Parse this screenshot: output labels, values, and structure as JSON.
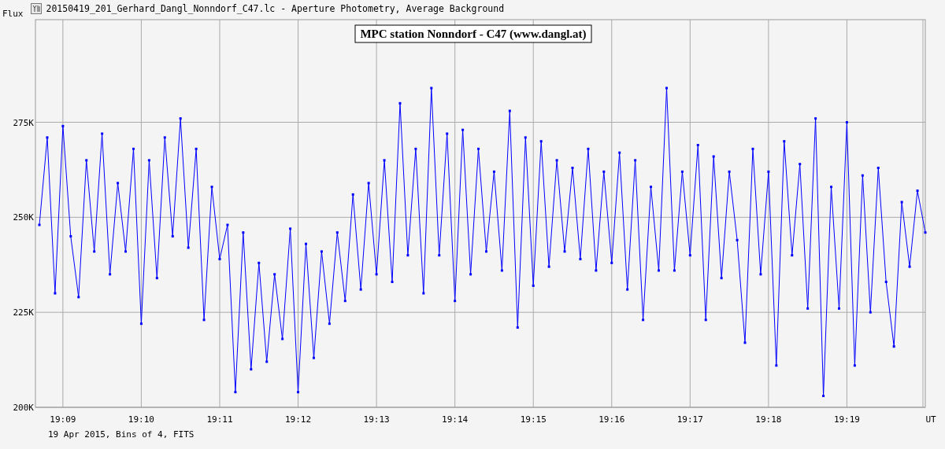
{
  "window": {
    "title": "20150419_201_Gerhard_Dangl_Nonndorf_C47.lc - Aperture Photometry, Average Background"
  },
  "chart": {
    "chart_data": {
      "type": "line",
      "title": "MPC station Nonndorf - C47 (www.dangl.at)",
      "xlabel": "UT",
      "ylabel": "Flux",
      "ylim": [
        200,
        302
      ],
      "grid": true,
      "yticks": [
        {
          "value": 200,
          "label": "200K"
        },
        {
          "value": 225,
          "label": "225K"
        },
        {
          "value": 250,
          "label": "250K"
        },
        {
          "value": 275,
          "label": "275K"
        }
      ],
      "categories": [
        null,
        null,
        null,
        "19:09",
        null,
        null,
        null,
        null,
        null,
        null,
        null,
        null,
        null,
        "19:10",
        null,
        null,
        null,
        null,
        null,
        null,
        null,
        null,
        null,
        "19:11",
        null,
        null,
        null,
        null,
        null,
        null,
        null,
        null,
        null,
        "19:12",
        null,
        null,
        null,
        null,
        null,
        null,
        null,
        null,
        null,
        "19:13",
        null,
        null,
        null,
        null,
        null,
        null,
        null,
        null,
        null,
        "19:14",
        null,
        null,
        null,
        null,
        null,
        null,
        null,
        null,
        null,
        "19:15",
        null,
        null,
        null,
        null,
        null,
        null,
        null,
        null,
        null,
        "19:16",
        null,
        null,
        null,
        null,
        null,
        null,
        null,
        null,
        null,
        "19:17",
        null,
        null,
        null,
        null,
        null,
        null,
        null,
        null,
        null,
        "19:18",
        null,
        null,
        null,
        null,
        null,
        null,
        null,
        null,
        null,
        "19:19",
        null,
        null,
        null,
        null,
        null,
        null,
        null,
        null,
        null,
        null
      ],
      "series": [
        {
          "color": "#0000ff",
          "marker": "square",
          "values": [
            248,
            271,
            230,
            274,
            245,
            229,
            265,
            241,
            272,
            235,
            259,
            241,
            268,
            222,
            265,
            234,
            271,
            245,
            276,
            242,
            268,
            223,
            258,
            239,
            248,
            204,
            246,
            210,
            238,
            212,
            235,
            218,
            247,
            204,
            243,
            213,
            241,
            222,
            246,
            228,
            256,
            231,
            259,
            235,
            265,
            233,
            280,
            240,
            268,
            230,
            284,
            240,
            272,
            228,
            273,
            235,
            268,
            241,
            262,
            236,
            278,
            221,
            271,
            232,
            270,
            237,
            265,
            241,
            263,
            239,
            268,
            236,
            262,
            238,
            267,
            231,
            265,
            223,
            258,
            236,
            284,
            236,
            262,
            240,
            269,
            223,
            266,
            234,
            262,
            244,
            217,
            268,
            235,
            262,
            211,
            270,
            240,
            264,
            226,
            276,
            203,
            258,
            226,
            275,
            211,
            261,
            225,
            263,
            233,
            216,
            254,
            237,
            257,
            246
          ]
        }
      ]
    }
  },
  "footer": "19 Apr 2015, Bins of 4, FITS"
}
